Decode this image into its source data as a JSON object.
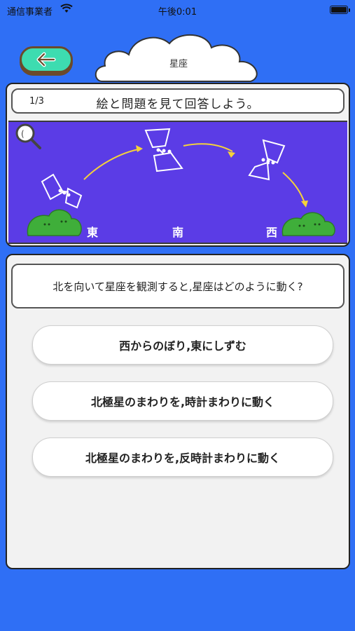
{
  "status_bar": {
    "carrier": "通信事業者",
    "time": "午後0:01"
  },
  "header": {
    "title": "星座",
    "back_icon": "back-arrow-icon"
  },
  "quiz": {
    "progress": "1/3",
    "instruction": "絵と問題を見て回答しよう。",
    "directions": {
      "east": "東",
      "south": "南",
      "west": "西"
    },
    "question": "北を向いて星座を観測すると,星座はどのように動く?",
    "answers": [
      "西からのぼり,東にしずむ",
      "北極星のまわりを,時計まわりに動く",
      "北極星のまわりを,反時計まわりに動く"
    ]
  },
  "colors": {
    "background": "#2f6ff5",
    "back_button": "#3ddcb0",
    "sky": "#5b3ce6",
    "arrow": "#f5d23a",
    "hill": "#3fae3a"
  }
}
